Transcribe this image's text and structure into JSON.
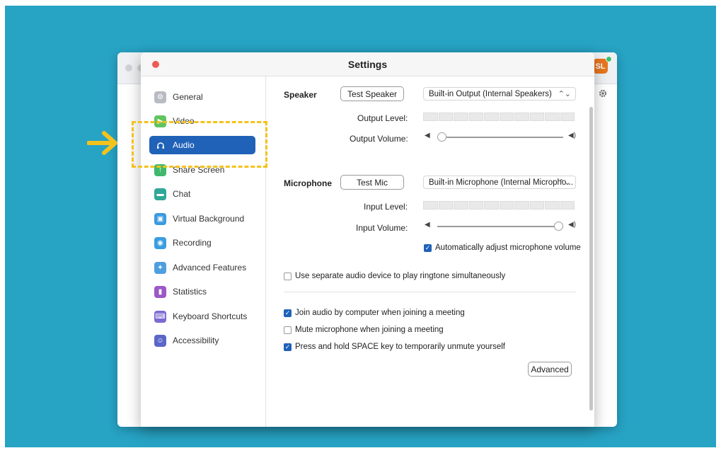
{
  "colors": {
    "background": "#27a3c4",
    "accent": "#1f62b8",
    "highlight": "#f3c21e",
    "close": "#ee5a55"
  },
  "back_window": {
    "avatar": "SL"
  },
  "window": {
    "title": "Settings"
  },
  "sidebar": {
    "items": [
      {
        "label": "General",
        "icon": "gear-icon",
        "color": "#b9bcc2"
      },
      {
        "label": "Video",
        "icon": "video-camera-icon",
        "color": "#60c45f"
      },
      {
        "label": "Audio",
        "icon": "headphones-icon",
        "color": "#1f62b8",
        "active": true
      },
      {
        "label": "Share Screen",
        "icon": "share-screen-icon",
        "color": "#3fb86b"
      },
      {
        "label": "Chat",
        "icon": "chat-bubble-icon",
        "color": "#2fa89a"
      },
      {
        "label": "Virtual Background",
        "icon": "person-portrait-icon",
        "color": "#3b9be0"
      },
      {
        "label": "Recording",
        "icon": "record-icon",
        "color": "#3a9ee0"
      },
      {
        "label": "Advanced Features",
        "icon": "sparkles-icon",
        "color": "#4f9fe0"
      },
      {
        "label": "Statistics",
        "icon": "bar-chart-icon",
        "color": "#9b59c6"
      },
      {
        "label": "Keyboard Shortcuts",
        "icon": "keyboard-icon",
        "color": "#7a6bd0"
      },
      {
        "label": "Accessibility",
        "icon": "accessibility-icon",
        "color": "#5b66c9"
      }
    ]
  },
  "speaker": {
    "section_label": "Speaker",
    "test_button": "Test Speaker",
    "device": "Built-in Output (Internal Speakers)",
    "output_level_label": "Output Level:",
    "output_volume_label": "Output Volume:",
    "output_volume": 0.0
  },
  "microphone": {
    "section_label": "Microphone",
    "test_button": "Test Mic",
    "device": "Built-in Microphone (Internal Micropho...",
    "input_level_label": "Input Level:",
    "input_volume_label": "Input Volume:",
    "input_volume": 1.0,
    "auto_adjust": {
      "label": "Automatically adjust microphone volume",
      "checked": true
    }
  },
  "options": [
    {
      "label": "Use separate audio device to play ringtone simultaneously",
      "checked": false
    },
    {
      "label": "Join audio by computer when joining a meeting",
      "checked": true
    },
    {
      "label": "Mute microphone when joining a meeting",
      "checked": false
    },
    {
      "label": "Press and hold SPACE key to temporarily unmute yourself",
      "checked": true
    }
  ],
  "advanced_button": "Advanced"
}
